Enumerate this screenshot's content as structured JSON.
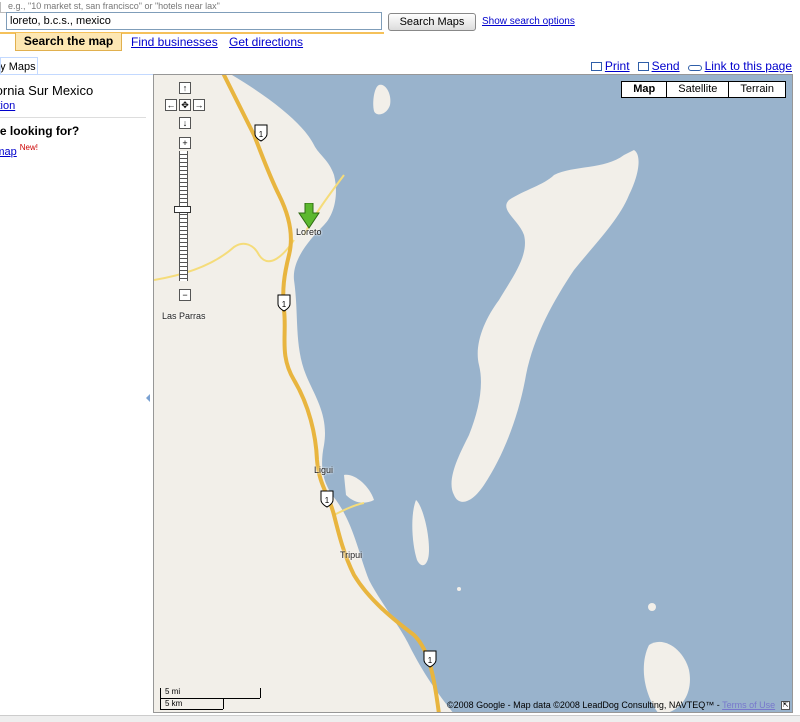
{
  "search": {
    "hint": "e.g., \"10 market st, san francisco\" or \"hotels near lax\"",
    "value": "loreto, b.c.s., mexico",
    "button": "Search Maps",
    "options_link": "Show search options"
  },
  "tabs": {
    "active": "Search the map",
    "find_businesses": "Find businesses",
    "get_directions": "Get directions"
  },
  "panel": {
    "tab": "My Maps",
    "location_title": "Baja California Sur Mexico",
    "default_location": "Set as default location",
    "looking_for": "Not what you're looking for?",
    "edit_map": "Edit the map",
    "new_badge": "New!"
  },
  "actions": {
    "print": "Print",
    "send": "Send",
    "link": "Link to this page"
  },
  "map": {
    "types": [
      "Map",
      "Satellite",
      "Terrain"
    ],
    "selected_type": "Map",
    "places": [
      "Loreto",
      "Las Parras",
      "Ligui",
      "Tripui"
    ],
    "highway_shield": "MEX 1",
    "scale": {
      "imperial": "5 mi",
      "metric": "5 km"
    },
    "copyright": "©2008 Google - Map data ©2008 LeadDog Consulting, NAVTEQ™ - ",
    "terms": "Terms of Use",
    "colors": {
      "water": "#99b3cc",
      "land": "#f2efe9",
      "highway": "#e8b53f",
      "road": "#f5dc7a"
    }
  },
  "pan_zoom": {
    "up": "↑",
    "left": "←",
    "center": "✥",
    "right": "→",
    "down": "↓",
    "zoom_in": "+",
    "zoom_out": "−"
  }
}
